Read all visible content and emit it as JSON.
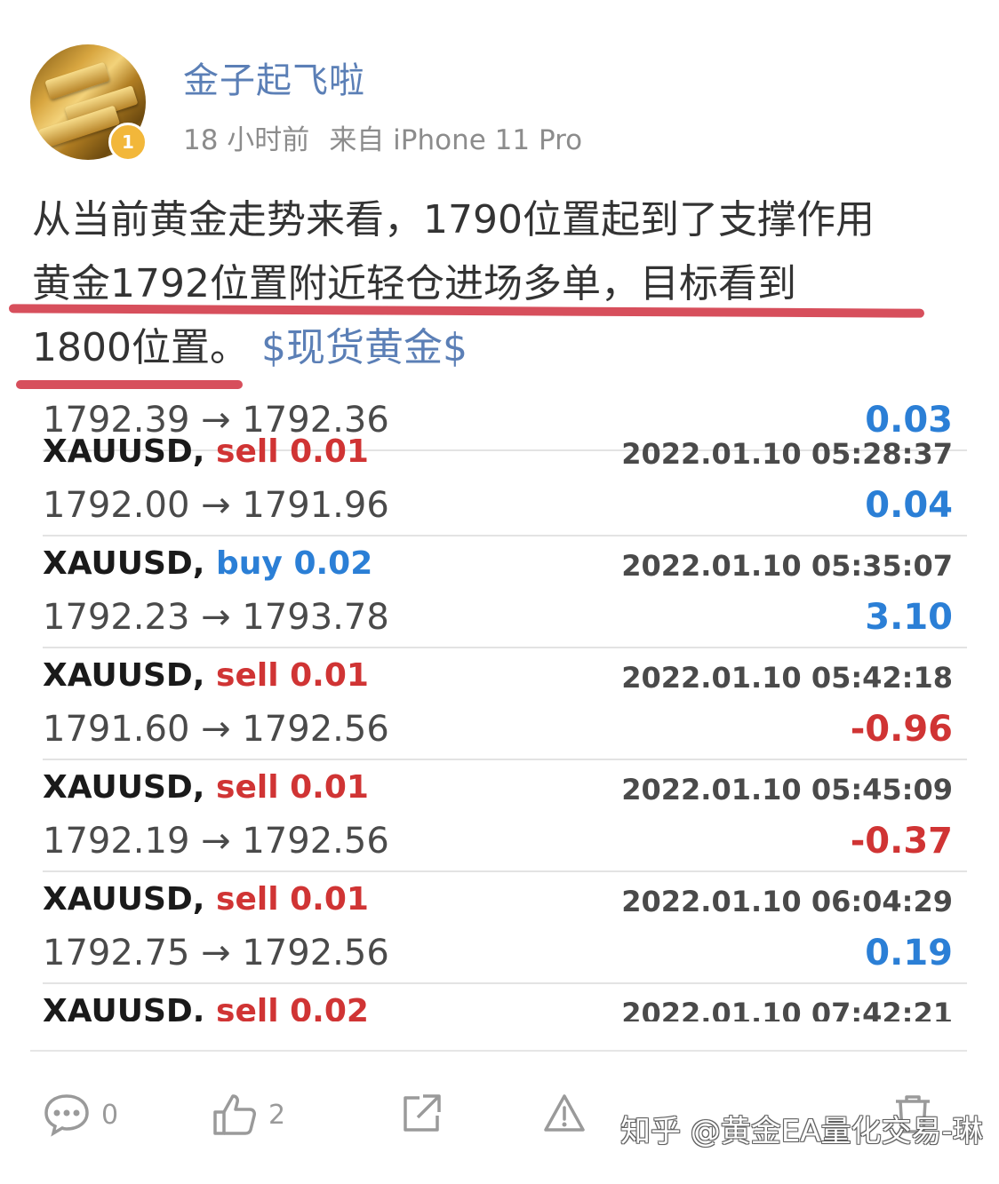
{
  "post": {
    "username": "金子起飞啦",
    "badge_level": "1",
    "time": "18 小时前",
    "source": "来自 iPhone 11 Pro",
    "text_line1": "从当前黄金走势来看，1790位置起到了支撑作用",
    "text_line2": "黄金1792位置附近轻仓进场多单，目标看到",
    "text_line3": "1800位置。",
    "topic": "$现货黄金$"
  },
  "trades": [
    {
      "symbol": "",
      "side": "",
      "volume": "",
      "time": "",
      "price": "1792.39 → 1792.36",
      "profit": "0.03",
      "profit_color": "#2b7fd6"
    },
    {
      "symbol": "XAUUSD,",
      "side": "sell",
      "volume": "0.01",
      "time": "2022.01.10 05:28:37",
      "price": "1792.00 → 1791.96",
      "profit": "0.04",
      "profit_color": "#2b7fd6"
    },
    {
      "symbol": "XAUUSD,",
      "side": "buy",
      "volume": "0.02",
      "time": "2022.01.10 05:35:07",
      "price": "1792.23 → 1793.78",
      "profit": "3.10",
      "profit_color": "#2b7fd6"
    },
    {
      "symbol": "XAUUSD,",
      "side": "sell",
      "volume": "0.01",
      "time": "2022.01.10 05:42:18",
      "price": "1791.60 → 1792.56",
      "profit": "-0.96",
      "profit_color": "#d03434"
    },
    {
      "symbol": "XAUUSD,",
      "side": "sell",
      "volume": "0.01",
      "time": "2022.01.10 05:45:09",
      "price": "1792.19 → 1792.56",
      "profit": "-0.37",
      "profit_color": "#d03434"
    },
    {
      "symbol": "XAUUSD,",
      "side": "sell",
      "volume": "0.01",
      "time": "2022.01.10 06:04:29",
      "price": "1792.75 → 1792.56",
      "profit": "0.19",
      "profit_color": "#2b7fd6"
    },
    {
      "symbol": "XAUUSD,",
      "side": "sell",
      "volume": "0.02",
      "time": "2022.01.10 07:42:21",
      "price": "",
      "profit": "",
      "profit_color": "#2b7fd6"
    }
  ],
  "actions": {
    "comment_count": "0",
    "like_count": "2"
  },
  "watermark": "知乎 @黄金EA量化交易-琳",
  "colors": {
    "link": "#5b7fb6",
    "sell": "#d03434",
    "buy": "#2b7fd6",
    "underline": "#d0303f"
  }
}
